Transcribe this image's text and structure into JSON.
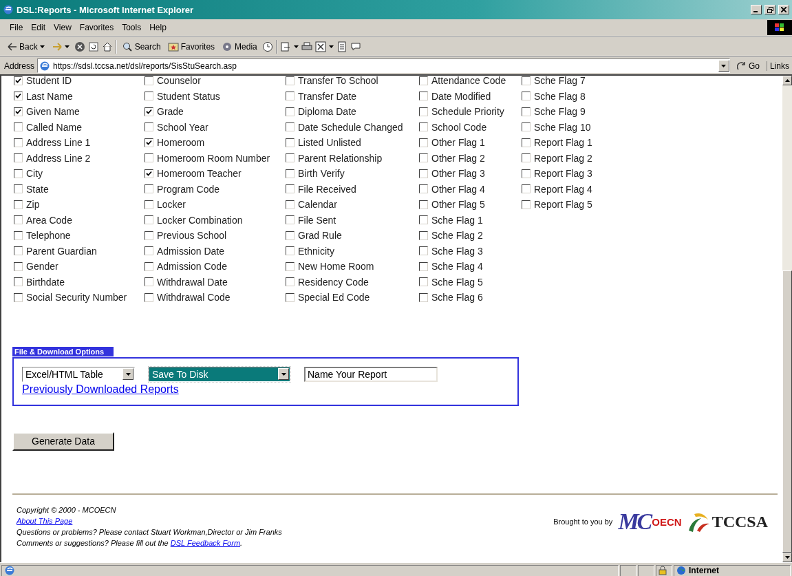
{
  "window": {
    "title": "DSL:Reports - Microsoft Internet Explorer"
  },
  "menu": [
    "File",
    "Edit",
    "View",
    "Favorites",
    "Tools",
    "Help"
  ],
  "toolbar": {
    "back": "Back",
    "search": "Search",
    "favorites": "Favorites",
    "media": "Media"
  },
  "address_bar": {
    "label": "Address",
    "url": "https://sdsl.tccsa.net/dsl/reports/SisStuSearch.asp",
    "go": "Go",
    "links": "Links"
  },
  "field_columns": [
    [
      {
        "label": "Student ID",
        "checked": true
      },
      {
        "label": "Last Name",
        "checked": true
      },
      {
        "label": "Given Name",
        "checked": true
      },
      {
        "label": "Called Name",
        "checked": false
      },
      {
        "label": "Address Line 1",
        "checked": false
      },
      {
        "label": "Address Line 2",
        "checked": false
      },
      {
        "label": "City",
        "checked": false
      },
      {
        "label": "State",
        "checked": false
      },
      {
        "label": "Zip",
        "checked": false
      },
      {
        "label": "Area Code",
        "checked": false
      },
      {
        "label": "Telephone",
        "checked": false
      },
      {
        "label": "Parent Guardian",
        "checked": false
      },
      {
        "label": "Gender",
        "checked": false
      },
      {
        "label": "Birthdate",
        "checked": false
      },
      {
        "label": "Social Security Number",
        "checked": false
      }
    ],
    [
      {
        "label": "Counselor",
        "checked": false
      },
      {
        "label": "Student Status",
        "checked": false
      },
      {
        "label": "Grade",
        "checked": true
      },
      {
        "label": "School Year",
        "checked": false
      },
      {
        "label": "Homeroom",
        "checked": true
      },
      {
        "label": "Homeroom Room Number",
        "checked": false
      },
      {
        "label": "Homeroom Teacher",
        "checked": true
      },
      {
        "label": "Program Code",
        "checked": false
      },
      {
        "label": "Locker",
        "checked": false
      },
      {
        "label": "Locker Combination",
        "checked": false
      },
      {
        "label": "Previous School",
        "checked": false
      },
      {
        "label": "Admission Date",
        "checked": false
      },
      {
        "label": "Admission Code",
        "checked": false
      },
      {
        "label": "Withdrawal Date",
        "checked": false
      },
      {
        "label": "Withdrawal Code",
        "checked": false
      }
    ],
    [
      {
        "label": "Transfer To School",
        "checked": false
      },
      {
        "label": "Transfer Date",
        "checked": false
      },
      {
        "label": "Diploma Date",
        "checked": false
      },
      {
        "label": "Date Schedule Changed",
        "checked": false
      },
      {
        "label": "Listed Unlisted",
        "checked": false
      },
      {
        "label": "Parent Relationship",
        "checked": false
      },
      {
        "label": "Birth Verify",
        "checked": false
      },
      {
        "label": "File Received",
        "checked": false
      },
      {
        "label": "Calendar",
        "checked": false
      },
      {
        "label": "File Sent",
        "checked": false
      },
      {
        "label": "Grad Rule",
        "checked": false
      },
      {
        "label": "Ethnicity",
        "checked": false
      },
      {
        "label": "New Home Room",
        "checked": false
      },
      {
        "label": "Residency Code",
        "checked": false
      },
      {
        "label": "Special Ed Code",
        "checked": false
      }
    ],
    [
      {
        "label": "Attendance Code",
        "checked": false
      },
      {
        "label": "Date Modified",
        "checked": false
      },
      {
        "label": "Schedule Priority",
        "checked": false
      },
      {
        "label": "School Code",
        "checked": false
      },
      {
        "label": "Other Flag 1",
        "checked": false
      },
      {
        "label": "Other Flag 2",
        "checked": false
      },
      {
        "label": "Other Flag 3",
        "checked": false
      },
      {
        "label": "Other Flag 4",
        "checked": false
      },
      {
        "label": "Other Flag 5",
        "checked": false
      },
      {
        "label": "Sche Flag 1",
        "checked": false
      },
      {
        "label": "Sche Flag 2",
        "checked": false
      },
      {
        "label": "Sche Flag 3",
        "checked": false
      },
      {
        "label": "Sche Flag 4",
        "checked": false
      },
      {
        "label": "Sche Flag 5",
        "checked": false
      },
      {
        "label": "Sche Flag 6",
        "checked": false
      }
    ],
    [
      {
        "label": "Sche Flag 7",
        "checked": false
      },
      {
        "label": "Sche Flag 8",
        "checked": false
      },
      {
        "label": "Sche Flag 9",
        "checked": false
      },
      {
        "label": "Sche Flag 10",
        "checked": false
      },
      {
        "label": "Report Flag 1",
        "checked": false
      },
      {
        "label": "Report Flag 2",
        "checked": false
      },
      {
        "label": "Report Flag 3",
        "checked": false
      },
      {
        "label": "Report Flag 4",
        "checked": false
      },
      {
        "label": "Report Flag 5",
        "checked": false
      }
    ]
  ],
  "download_options": {
    "legend": "File & Download Options",
    "format": "Excel/HTML Table",
    "destination": "Save To Disk",
    "report_name": "Name Your Report",
    "history_link": "Previously Downloaded Reports"
  },
  "generate_button": "Generate Data",
  "footer": {
    "copyright": "Copyright © 2000 - MCOECN",
    "about_link": "About This Page",
    "questions": "Questions or problems? Please contact Stuart Workman,Director or Jim Franks",
    "comments_prefix": "Comments or suggestions? Please fill out the ",
    "feedback_link": "DSL Feedback Form",
    "comments_suffix": ".",
    "brought_by": "Brought to you by",
    "logo_mc": "MC",
    "logo_oecn": "OECN",
    "logo_tccsa": "TCCSA"
  },
  "status_bar": {
    "zone": "Internet"
  }
}
